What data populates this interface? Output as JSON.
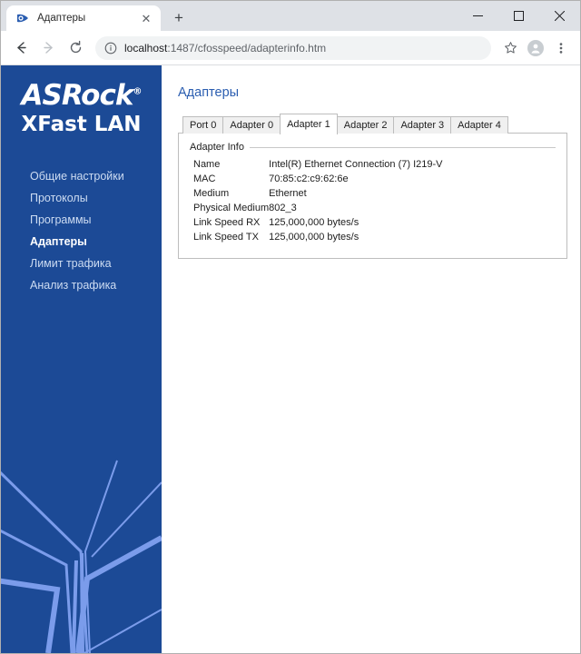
{
  "browser": {
    "tab": {
      "title": "Адаптеры",
      "favicon": "cfosspeed-favicon",
      "close_label": "✕"
    },
    "newtab_label": "+",
    "window_controls": {
      "minimize": "minimize-icon",
      "maximize": "maximize-icon",
      "close": "close-icon"
    },
    "nav": {
      "back": "back-arrow-icon",
      "forward": "forward-arrow-icon",
      "reload": "reload-icon"
    },
    "omnibox": {
      "info_icon": "site-info-icon",
      "host": "localhost",
      "path": ":1487/cfosspeed/adapterinfo.htm",
      "full_url": "localhost:1487/cfosspeed/adapterinfo.htm"
    },
    "toolbar_icons": {
      "bookmark": "star-icon",
      "profile": "avatar-icon",
      "menu": "three-dot-menu-icon"
    }
  },
  "sidebar": {
    "brand": "ASRock",
    "brand_registered": "®",
    "product": "XFast LAN",
    "items": [
      {
        "label": "Общие настройки",
        "active": false
      },
      {
        "label": "Протоколы",
        "active": false
      },
      {
        "label": "Программы",
        "active": false
      },
      {
        "label": "Адаптеры",
        "active": true
      },
      {
        "label": "Лимит трафика",
        "active": false
      },
      {
        "label": "Анализ трафика",
        "active": false
      }
    ],
    "background_color": "#1c4a96",
    "accent_color": "#7b9ceb"
  },
  "main": {
    "title": "Адаптеры",
    "title_color": "#2a5db0",
    "tabs": [
      {
        "label": "Port 0",
        "active": false
      },
      {
        "label": "Adapter 0",
        "active": false
      },
      {
        "label": "Adapter 1",
        "active": true
      },
      {
        "label": "Adapter 2",
        "active": false
      },
      {
        "label": "Adapter 3",
        "active": false
      },
      {
        "label": "Adapter 4",
        "active": false
      }
    ],
    "panel": {
      "legend": "Adapter Info",
      "rows": [
        {
          "key": "Name",
          "value": "Intel(R) Ethernet Connection (7) I219-V"
        },
        {
          "key": "MAC",
          "value": "70:85:c2:c9:62:6e"
        },
        {
          "key": "Medium",
          "value": "Ethernet"
        },
        {
          "key": "Physical Medium",
          "value": "802_3"
        },
        {
          "key": "Link Speed RX",
          "value": "125,000,000 bytes/s"
        },
        {
          "key": "Link Speed TX",
          "value": "125,000,000 bytes/s"
        }
      ]
    }
  }
}
